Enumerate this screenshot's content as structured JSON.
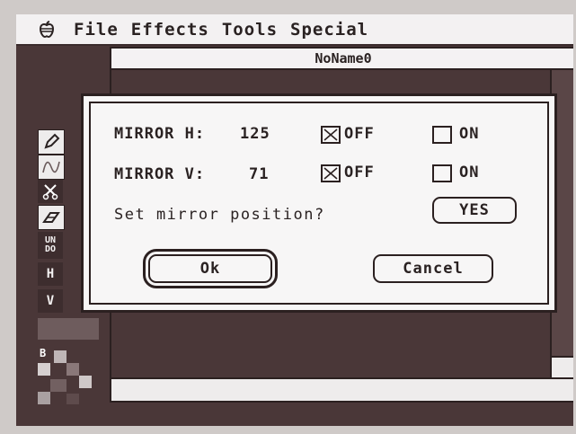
{
  "menubar": {
    "apple_icon": "apple-icon",
    "items": [
      "File",
      "Effects",
      "Tools",
      "Special"
    ]
  },
  "window": {
    "title": "NoName0"
  },
  "palette": {
    "tools": [
      "pencil-icon",
      "curve-icon",
      "scissors-icon",
      "eraser-icon"
    ],
    "undo_label": "UN DO",
    "h_label": "H",
    "v_label": "V",
    "pattern_label": "B"
  },
  "dialog": {
    "mirror_h": {
      "label": "MIRROR H:",
      "value": "125",
      "off_label": "OFF",
      "on_label": "ON",
      "off_checked": true,
      "on_checked": false
    },
    "mirror_v": {
      "label": "MIRROR V:",
      "value": "71",
      "off_label": "OFF",
      "on_label": "ON",
      "off_checked": true,
      "on_checked": false
    },
    "question": "Set mirror position?",
    "yes_label": "YES",
    "ok_label": "Ok",
    "cancel_label": "Cancel"
  }
}
